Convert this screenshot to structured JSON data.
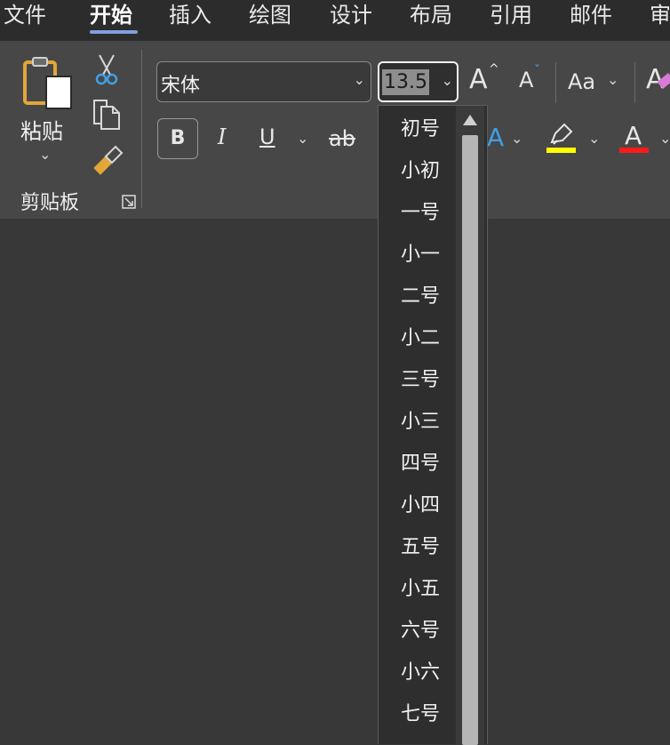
{
  "menu": {
    "tabs": [
      "文件",
      "开始",
      "插入",
      "绘图",
      "设计",
      "布局",
      "引用",
      "邮件",
      "审"
    ],
    "active_index": 1
  },
  "clipboard": {
    "paste_label": "粘贴",
    "group_label": "剪贴板"
  },
  "font": {
    "name": "宋体",
    "size": "13.5",
    "change_case_label": "Aa"
  },
  "format": {
    "bold": "B",
    "italic": "I",
    "underline": "U",
    "strikethrough": "ab"
  },
  "size_dropdown": {
    "options": [
      "初号",
      "小初",
      "一号",
      "小一",
      "二号",
      "小二",
      "三号",
      "小三",
      "四号",
      "小四",
      "五号",
      "小五",
      "六号",
      "小六",
      "七号"
    ]
  },
  "colors": {
    "highlight": "#ffff00",
    "font_color": "#ff1a1a",
    "accent": "#7fa0df"
  },
  "icons": [
    "paste-icon",
    "cut-icon",
    "copy-icon",
    "format-painter-icon",
    "dialog-launcher-icon",
    "grow-font-icon",
    "shrink-font-icon",
    "clear-format-icon",
    "text-effects-icon",
    "highlight-icon",
    "font-color-icon",
    "chevron-down-icon",
    "scroll-up-icon"
  ]
}
